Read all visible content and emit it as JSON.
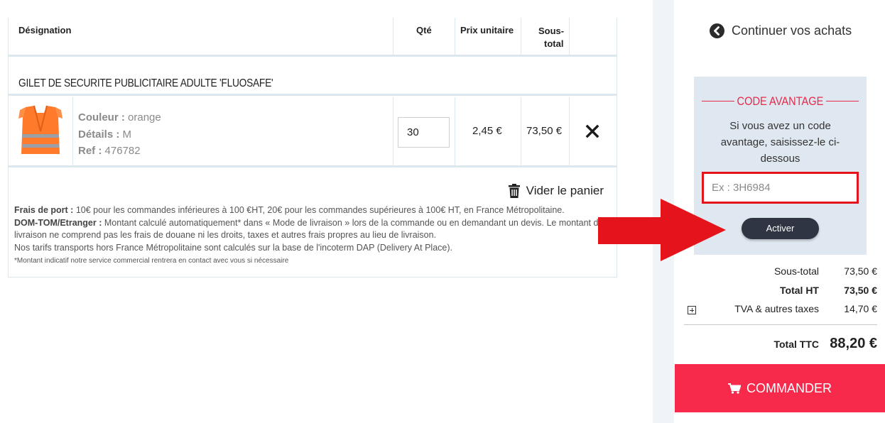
{
  "table_header": {
    "designation": "Désignation",
    "qty": "Qté",
    "unit_price": "Prix unitaire",
    "subtotal_line1": "Sous-",
    "subtotal_line2": "total"
  },
  "product": {
    "title": "GILET DE SECURITE PUBLICITAIRE ADULTE 'FLUOSAFE'",
    "color_label": "Couleur :",
    "color_value": "orange",
    "details_label": "Détails :",
    "details_value": "M",
    "ref_label": "Ref :",
    "ref_value": "476782",
    "quantity": "30",
    "unit_price": "2,45 €",
    "subtotal": "73,50 €"
  },
  "cart_actions": {
    "empty_cart": "Vider le panier"
  },
  "shipping_notes": {
    "frais_label": "Frais de port :",
    "frais_text": "10€ pour les commandes inférieures à 100 €HT, 20€ pour les commandes supérieures à 100€ HT, en France Métropolitaine.",
    "domtom_label": "DOM-TOM/Etranger :",
    "domtom_text": "Montant calculé automatiquement* dans « Mode de livraison » lors de la commande ou en demandant un devis. Le montant de la livraison ne comprend pas les frais de douane ni les droits, taxes et autres frais propres au lieu de livraison.",
    "incoterm_text": "Nos tarifs transports hors France Métropolitaine sont calculés sur la base de l'incoterm DAP (Delivery At Place).",
    "footnote": "*Montant indicatif notre service commercial rentrera en contact avec vous si nécessaire"
  },
  "sidebar": {
    "continue_label": "Continuer vos achats",
    "promo": {
      "title": "CODE AVANTAGE",
      "text": "Si vous avez un code avantage, saisissez-le ci-dessous",
      "placeholder": "Ex : 3H6984",
      "activate_label": "Activer"
    },
    "totals": {
      "subtotal_label": "Sous-total",
      "subtotal_value": "73,50 €",
      "total_ht_label": "Total HT",
      "total_ht_value": "73,50 €",
      "tva_label": "TVA & autres taxes",
      "tva_value": "14,70 €",
      "total_ttc_label": "Total TTC",
      "total_ttc_value": "88,20 €"
    },
    "order_label": "COMMANDER"
  },
  "colors": {
    "accent_red": "#f72a4c",
    "promo_red": "#e8294a",
    "arrow_red": "#e5141c",
    "promo_bg": "#dfe8f0",
    "dark_button": "#2f3542"
  }
}
